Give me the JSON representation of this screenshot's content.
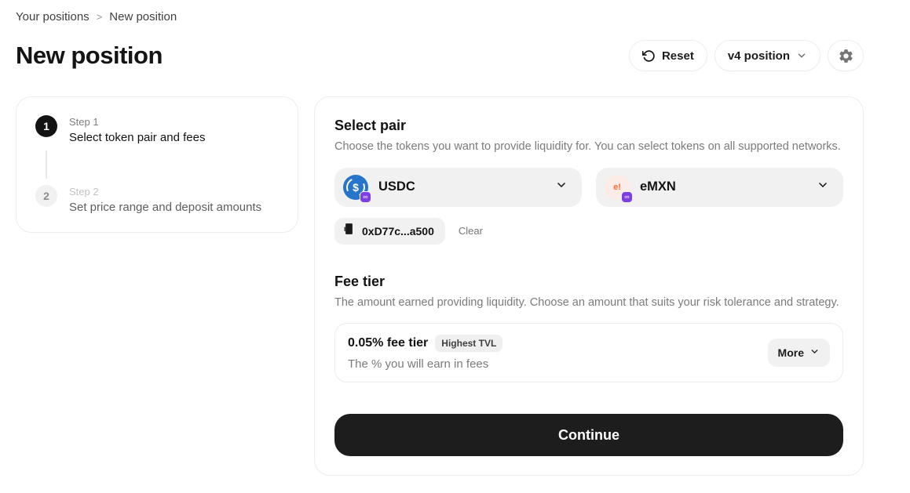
{
  "breadcrumb": {
    "items": [
      "Your positions",
      "New position"
    ],
    "separator": ">"
  },
  "header": {
    "title": "New position",
    "reset_label": "Reset",
    "version_label": "v4 position"
  },
  "steps": [
    {
      "number": "1",
      "label": "Step 1",
      "title": "Select token pair and fees"
    },
    {
      "number": "2",
      "label": "Step 2",
      "title": "Set price range and deposit amounts"
    }
  ],
  "select_pair": {
    "heading": "Select pair",
    "description": "Choose the tokens you want to provide liquidity for. You can select tokens on all supported networks.",
    "tokens": [
      {
        "symbol": "USDC",
        "icon_glyph": "$"
      },
      {
        "symbol": "eMXN",
        "icon_glyph": "e!"
      }
    ],
    "network_badge_glyph": "∞",
    "contract_chip": {
      "address": "0xD77c...a500",
      "clear_label": "Clear"
    }
  },
  "fee_tier": {
    "heading": "Fee tier",
    "description": "The amount earned providing liquidity. Choose an amount that suits your risk tolerance and strategy.",
    "selected": {
      "title": "0.05% fee tier",
      "badge": "Highest TVL",
      "subtitle": "The % you will earn in fees",
      "more_label": "More"
    }
  },
  "continue_label": "Continue",
  "colors": {
    "usdc_blue": "#2775CA",
    "network_badge_purple": "#7C3FE4",
    "emxn_icon_bg": "#FCECE7",
    "emxn_icon_text": "#FB6A33",
    "continue_bg": "#1D1D1D",
    "step_active_bg": "#131313",
    "surface_gray": "#F1F1F1"
  }
}
